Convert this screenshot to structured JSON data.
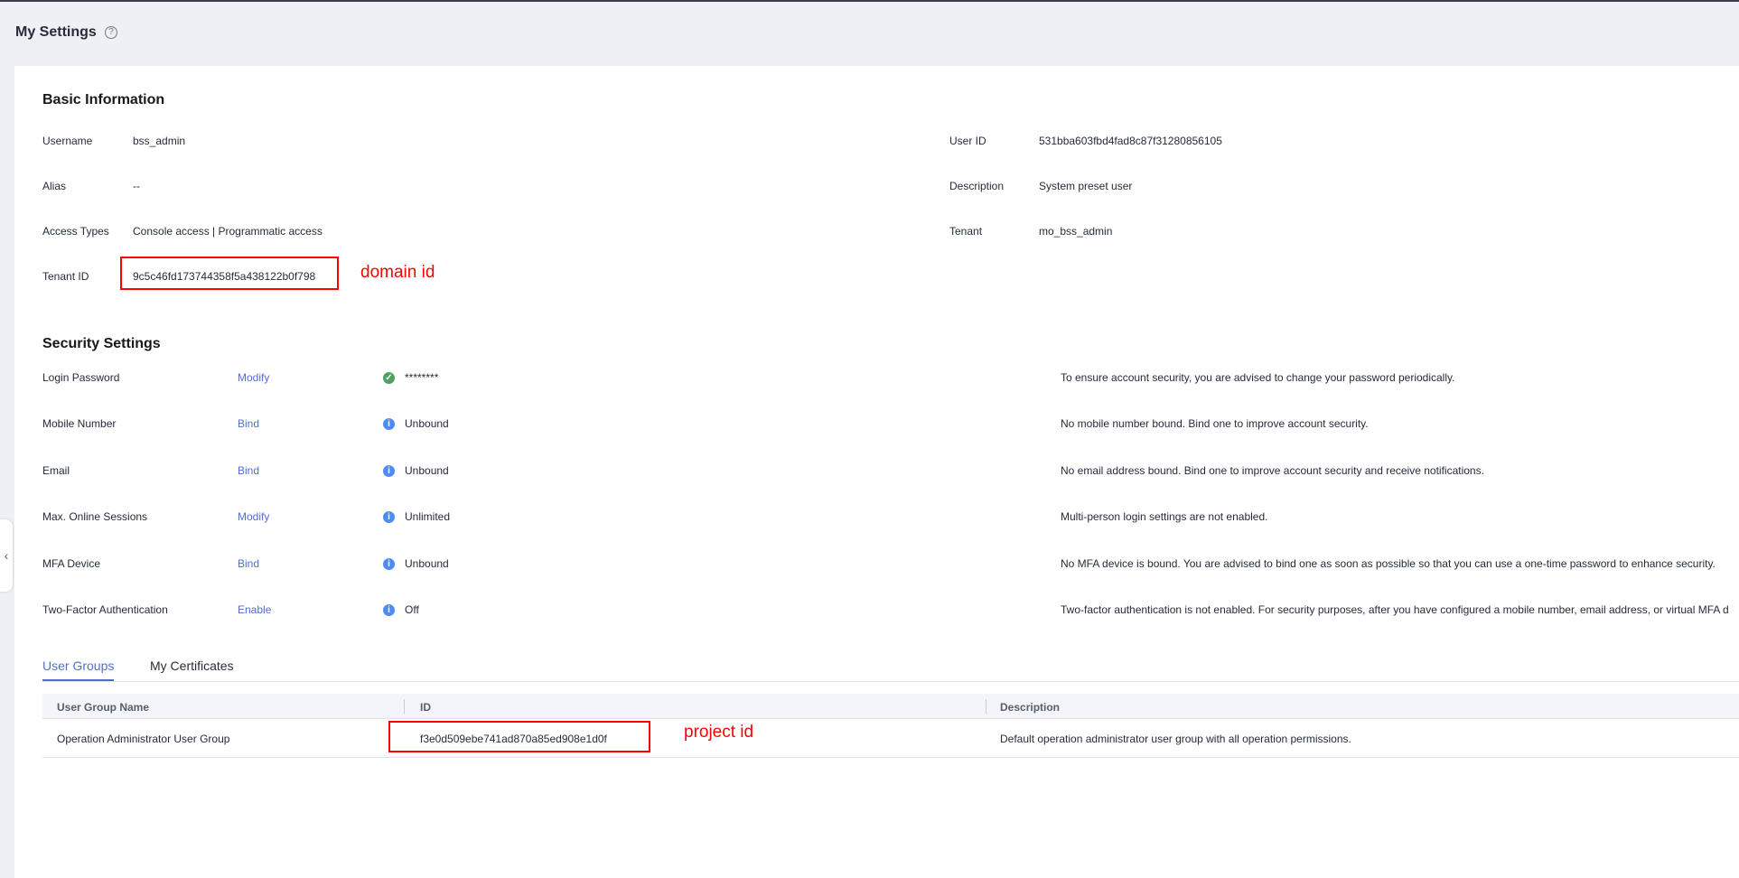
{
  "page": {
    "title": "My Settings",
    "help_icon": "question-circle-icon"
  },
  "basic": {
    "title": "Basic Information",
    "left": [
      {
        "label": "Username",
        "value": "bss_admin"
      },
      {
        "label": "Alias",
        "value": "--"
      },
      {
        "label": "Access Types",
        "value": "Console access | Programmatic access"
      },
      {
        "label": "Tenant ID",
        "value": "9c5c46fd173744358f5a438122b0f798"
      }
    ],
    "right": [
      {
        "label": "User ID",
        "value": "531bba603fbd4fad8c87f31280856105"
      },
      {
        "label": "Description",
        "value": "System preset user"
      },
      {
        "label": "Tenant",
        "value": "mo_bss_admin"
      }
    ],
    "annotation": "domain id"
  },
  "security": {
    "title": "Security Settings",
    "rows": [
      {
        "label": "Login Password",
        "action": "Modify",
        "status_icon": "check-circle-icon",
        "status": "********",
        "desc": "To ensure account security, you are advised to change your password periodically."
      },
      {
        "label": "Mobile Number",
        "action": "Bind",
        "status_icon": "info-circle-icon",
        "status": "Unbound",
        "desc": "No mobile number bound. Bind one to improve account security."
      },
      {
        "label": "Email",
        "action": "Bind",
        "status_icon": "info-circle-icon",
        "status": "Unbound",
        "desc": "No email address bound. Bind one to improve account security and receive notifications."
      },
      {
        "label": "Max. Online Sessions",
        "action": "Modify",
        "status_icon": "info-circle-icon",
        "status": "Unlimited",
        "desc": "Multi-person login settings are not enabled."
      },
      {
        "label": "MFA Device",
        "action": "Bind",
        "status_icon": "info-circle-icon",
        "status": "Unbound",
        "desc": "No MFA device is bound. You are advised to bind one as soon as possible so that you can use a one-time password to enhance security."
      },
      {
        "label": "Two-Factor Authentication",
        "action": "Enable",
        "status_icon": "info-circle-icon",
        "status": "Off",
        "desc": "Two-factor authentication is not enabled. For security purposes, after you have configured a mobile number, email address, or virtual MFA d"
      }
    ]
  },
  "tabs": [
    {
      "label": "User Groups",
      "active": true
    },
    {
      "label": "My Certificates",
      "active": false
    }
  ],
  "table": {
    "headers": [
      "User Group Name",
      "ID",
      "Description"
    ],
    "rows": [
      [
        "Operation Administrator User Group",
        "f3e0d509ebe741ad870a85ed908e1d0f",
        "Default operation administrator user group with all operation permissions."
      ]
    ],
    "annotation": "project id"
  },
  "colors": {
    "accent": "#526ecc",
    "annotation": "#ff0000"
  }
}
